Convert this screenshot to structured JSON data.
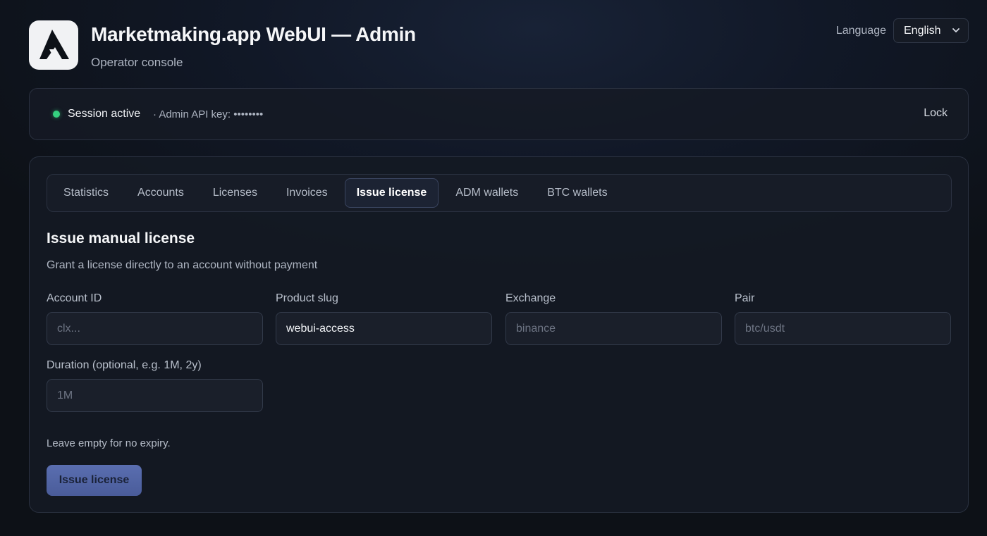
{
  "header": {
    "title": "Marketmaking.app WebUI — Admin",
    "subtitle": "Operator console",
    "language_label": "Language",
    "language_value": "English"
  },
  "session": {
    "status": "Session active",
    "key_text": "· Admin API key: ••••••••",
    "lock_label": "Lock",
    "status_color": "#35d07f"
  },
  "tabs": [
    {
      "label": "Statistics",
      "active": false
    },
    {
      "label": "Accounts",
      "active": false
    },
    {
      "label": "Licenses",
      "active": false
    },
    {
      "label": "Invoices",
      "active": false
    },
    {
      "label": "Issue license",
      "active": true
    },
    {
      "label": "ADM wallets",
      "active": false
    },
    {
      "label": "BTC wallets",
      "active": false
    }
  ],
  "form": {
    "title": "Issue manual license",
    "description": "Grant a license directly to an account without payment",
    "fields": {
      "account_id": {
        "label": "Account ID",
        "value": "",
        "placeholder": "clx..."
      },
      "product_slug": {
        "label": "Product slug",
        "value": "webui-access",
        "placeholder": ""
      },
      "exchange": {
        "label": "Exchange",
        "value": "",
        "placeholder": "binance"
      },
      "pair": {
        "label": "Pair",
        "value": "",
        "placeholder": "btc/usdt"
      },
      "duration": {
        "label": "Duration (optional, e.g. 1M, 2y)",
        "value": "",
        "placeholder": "1M"
      }
    },
    "hint": "Leave empty for no expiry.",
    "submit_label": "Issue license"
  },
  "icons": {
    "logo": "logo-icon",
    "language_select": "chevron-down-icon"
  },
  "colors": {
    "accent": "#4a5c9a",
    "background": "#0e131c"
  }
}
